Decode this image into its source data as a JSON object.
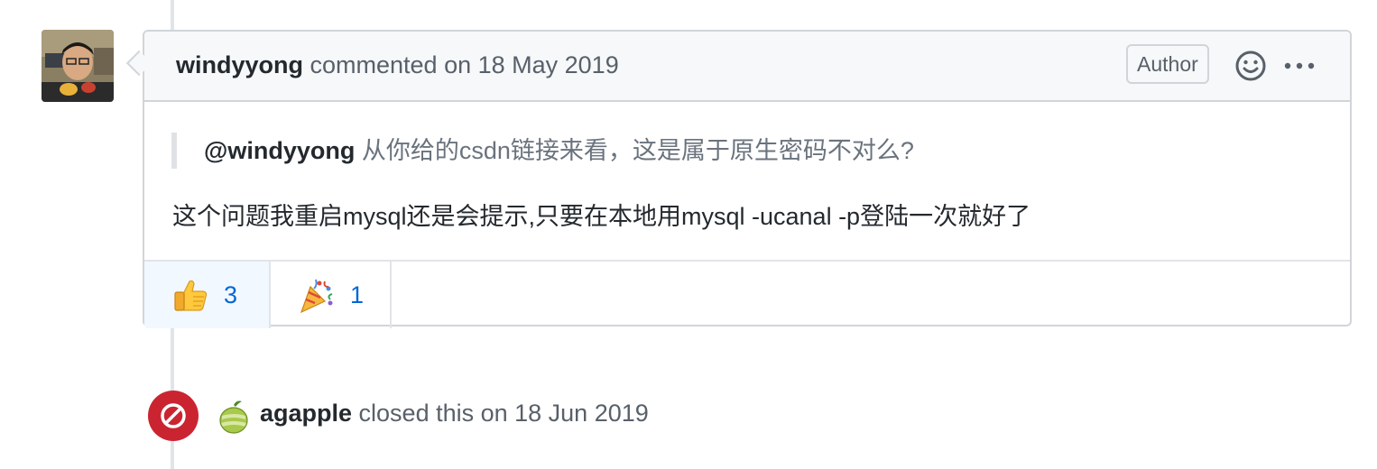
{
  "comment": {
    "author": "windyyong",
    "action_text": " commented on 18 May 2019",
    "badge": "Author",
    "header_icons": [
      "smiley-icon",
      "kebab-horizontal-icon"
    ],
    "quote": {
      "mention": "@windyyong",
      "text": " 从你给的csdn链接来看，这是属于原生密码不对么?"
    },
    "body_text": "这个问题我重启mysql还是会提示,只要在本地用mysql -ucanal -p登陆一次就好了",
    "reactions": [
      {
        "emoji": "thumbs-up-icon",
        "count": "3"
      },
      {
        "emoji": "party-popper-icon",
        "count": "1"
      }
    ]
  },
  "event": {
    "icon": "circle-slash-icon",
    "actor": "agapple",
    "action_text": " closed this on 18 Jun 2019",
    "colors": {
      "closed_badge": "#cb2431"
    }
  },
  "colors": {
    "link": "#0366d6",
    "muted": "#586069",
    "border": "#d1d5da",
    "header_bg": "#f6f8fa"
  }
}
